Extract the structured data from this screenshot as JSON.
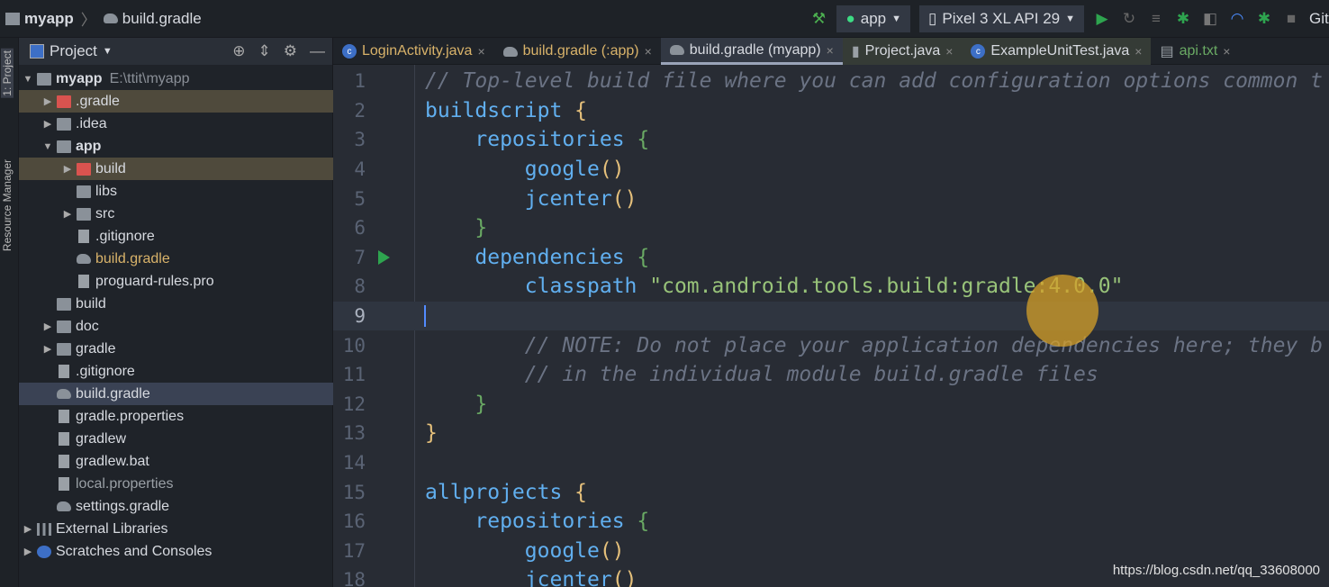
{
  "titlebar": {
    "project": "myapp",
    "file": "build.gradle",
    "run_config": "app",
    "device": "Pixel 3 XL API 29",
    "vcs": "Git:"
  },
  "left_toolwindows": [
    "1: Project",
    "Resource Manager"
  ],
  "panel": {
    "title": "Project",
    "tree": [
      {
        "label": "myapp",
        "extra": "E:\\ttit\\myapp",
        "level": 0,
        "arrow": "▼",
        "type": "folder",
        "bold": true
      },
      {
        "label": ".gradle",
        "level": 1,
        "arrow": "▶",
        "type": "folder-red",
        "hl": true
      },
      {
        "label": ".idea",
        "level": 1,
        "arrow": "▶",
        "type": "folder"
      },
      {
        "label": "app",
        "level": 1,
        "arrow": "▼",
        "type": "folder",
        "bold": true
      },
      {
        "label": "build",
        "level": 2,
        "arrow": "▶",
        "type": "folder-red",
        "hl": true
      },
      {
        "label": "libs",
        "level": 2,
        "type": "folder"
      },
      {
        "label": "src",
        "level": 2,
        "arrow": "▶",
        "type": "folder"
      },
      {
        "label": ".gitignore",
        "level": 2,
        "type": "file"
      },
      {
        "label": "build.gradle",
        "level": 2,
        "type": "gradle",
        "color": "#d9b36a"
      },
      {
        "label": "proguard-rules.pro",
        "level": 2,
        "type": "file"
      },
      {
        "label": "build",
        "level": 1,
        "type": "folder"
      },
      {
        "label": "doc",
        "level": 1,
        "arrow": "▶",
        "type": "folder"
      },
      {
        "label": "gradle",
        "level": 1,
        "arrow": "▶",
        "type": "folder"
      },
      {
        "label": ".gitignore",
        "level": 1,
        "type": "file"
      },
      {
        "label": "build.gradle",
        "level": 1,
        "type": "gradle",
        "sel": true
      },
      {
        "label": "gradle.properties",
        "level": 1,
        "type": "file"
      },
      {
        "label": "gradlew",
        "level": 1,
        "type": "file"
      },
      {
        "label": "gradlew.bat",
        "level": 1,
        "type": "file"
      },
      {
        "label": "local.properties",
        "level": 1,
        "type": "file",
        "color": "#9aa0a6"
      },
      {
        "label": "settings.gradle",
        "level": 1,
        "type": "gradle"
      },
      {
        "label": "External Libraries",
        "level": 0,
        "arrow": "▶",
        "type": "lib"
      },
      {
        "label": "Scratches and Consoles",
        "level": 0,
        "arrow": "▶",
        "type": "scratch"
      }
    ]
  },
  "tabs": [
    {
      "label": "LoginActivity.java",
      "icon": "c"
    },
    {
      "label": "build.gradle (:app)",
      "icon": "gradle"
    },
    {
      "label": "build.gradle (myapp)",
      "icon": "gradle",
      "active": true
    },
    {
      "label": "Project.java",
      "icon": "java",
      "dark": true
    },
    {
      "label": "ExampleUnitTest.java",
      "icon": "c",
      "dark": true
    },
    {
      "label": "api.txt",
      "icon": "txt",
      "color": "#6aaa64"
    }
  ],
  "editor": {
    "current_line": 9,
    "lines": [
      [
        [
          "c",
          "// Top-level build file where you can add configuration options common t"
        ]
      ],
      [
        [
          "kw",
          "buildscript "
        ],
        [
          "y",
          "{"
        ]
      ],
      [
        [
          "",
          "    "
        ],
        [
          "kw",
          "repositories "
        ],
        [
          "g",
          "{"
        ]
      ],
      [
        [
          "",
          "        "
        ],
        [
          "kw",
          "google"
        ],
        [
          "y",
          "()"
        ]
      ],
      [
        [
          "",
          "        "
        ],
        [
          "kw",
          "jcenter"
        ],
        [
          "y",
          "()"
        ]
      ],
      [
        [
          "",
          "    "
        ],
        [
          "g",
          "}"
        ]
      ],
      [
        [
          "",
          "    "
        ],
        [
          "kw",
          "dependencies "
        ],
        [
          "g",
          "{"
        ]
      ],
      [
        [
          "",
          "        "
        ],
        [
          "kw",
          "classpath "
        ],
        [
          "s",
          "\"com.android.tools.build:gradle:4.0.0\""
        ]
      ],
      [],
      [
        [
          "",
          "        "
        ],
        [
          "c",
          "// NOTE: Do not place your application dependencies here; they b"
        ]
      ],
      [
        [
          "",
          "        "
        ],
        [
          "c",
          "// in the individual module build.gradle files"
        ]
      ],
      [
        [
          "",
          "    "
        ],
        [
          "g",
          "}"
        ]
      ],
      [
        [
          "y",
          "}"
        ]
      ],
      [],
      [
        [
          "kw",
          "allprojects "
        ],
        [
          "y",
          "{"
        ]
      ],
      [
        [
          "",
          "    "
        ],
        [
          "kw",
          "repositories "
        ],
        [
          "g",
          "{"
        ]
      ],
      [
        [
          "",
          "        "
        ],
        [
          "kw",
          "google"
        ],
        [
          "y",
          "()"
        ]
      ],
      [
        [
          "",
          "        "
        ],
        [
          "kw",
          "jcenter"
        ],
        [
          "y",
          "()"
        ]
      ]
    ]
  },
  "watermark": "https://blog.csdn.net/qq_33608000"
}
